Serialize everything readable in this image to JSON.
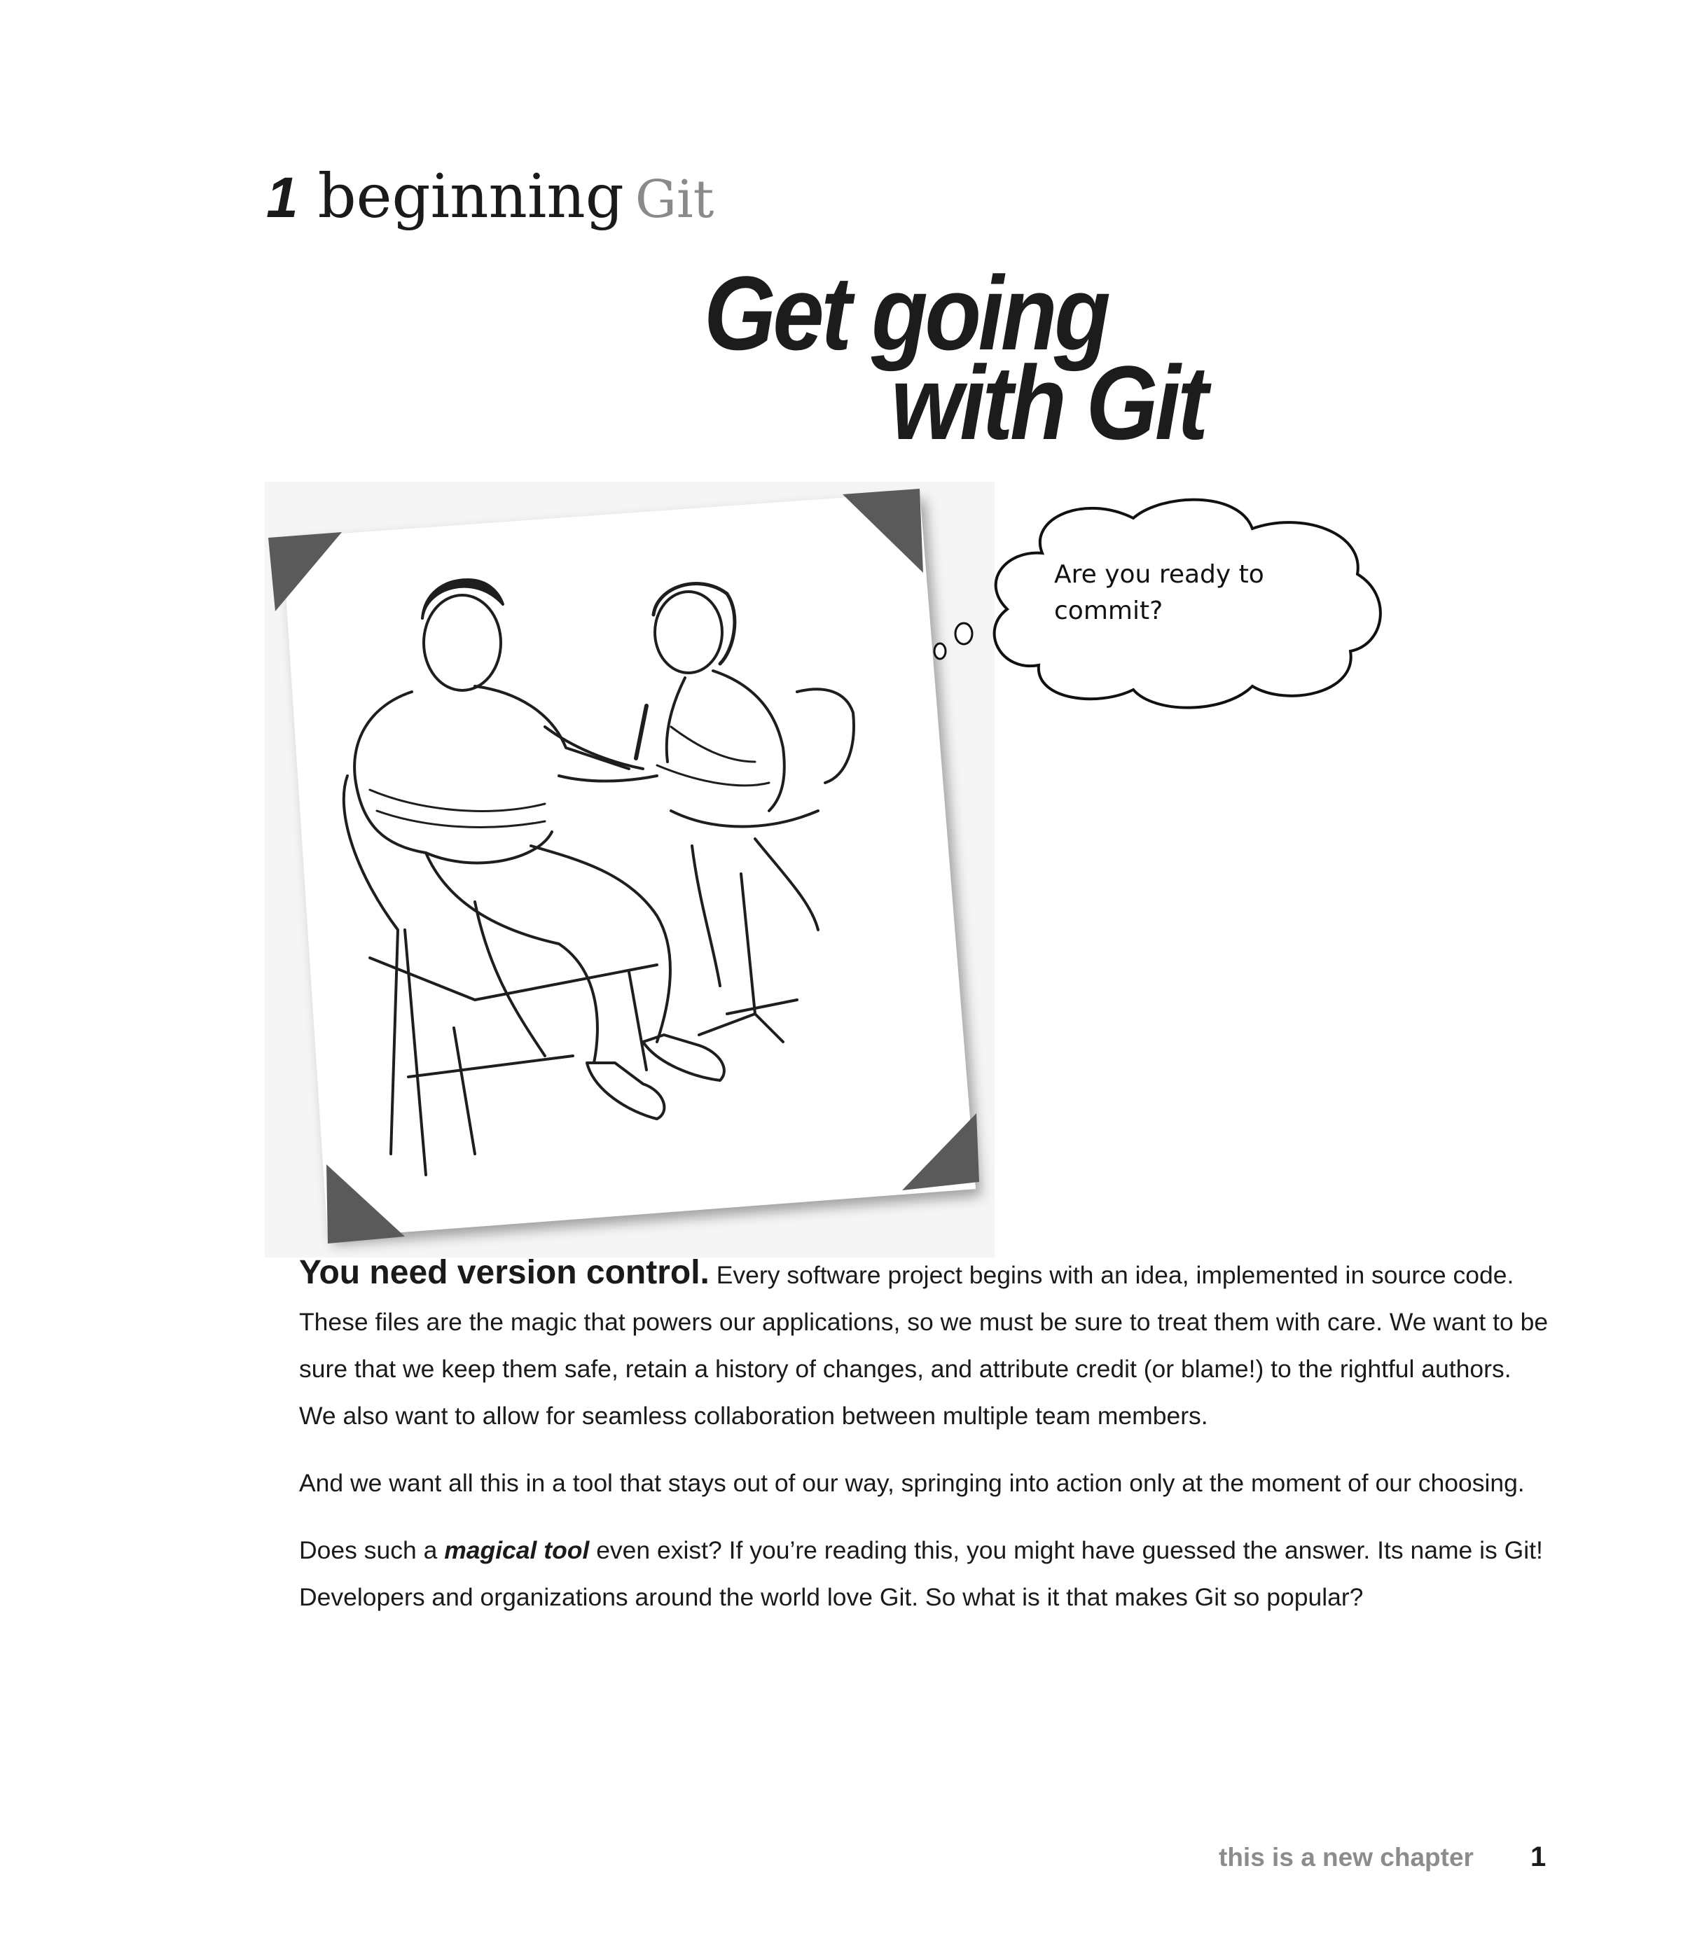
{
  "chapter": {
    "number": "1",
    "title": "beginning",
    "subject": "Git"
  },
  "headline": {
    "line1": "Get going",
    "line2": "with Git"
  },
  "bubble": {
    "line1": "Are you ready to",
    "line2": "commit?"
  },
  "body": {
    "p1_lead": "You need version control.",
    "p1_text": " Every software project begins with an idea, implemented in source code. These files are the magic that powers our applications, so we must be sure to treat them with care. We want to be sure that we keep them safe, retain a history of changes, and attribute credit (or blame!) to the rightful authors. We also want to allow for seamless collaboration between multiple team members.",
    "p2": "And we want all this in a tool that stays out of our way, springing into action only at the moment of our choosing.",
    "p3_before": "Does such a ",
    "p3_emph": "magical tool",
    "p3_after": " even exist? If you’re reading this, you might have guessed the answer. Its name is Git! Developers and organizations around the world love Git. So what is it that makes Git so popular?"
  },
  "footer": {
    "text": "this is a new chapter",
    "page": "1"
  }
}
